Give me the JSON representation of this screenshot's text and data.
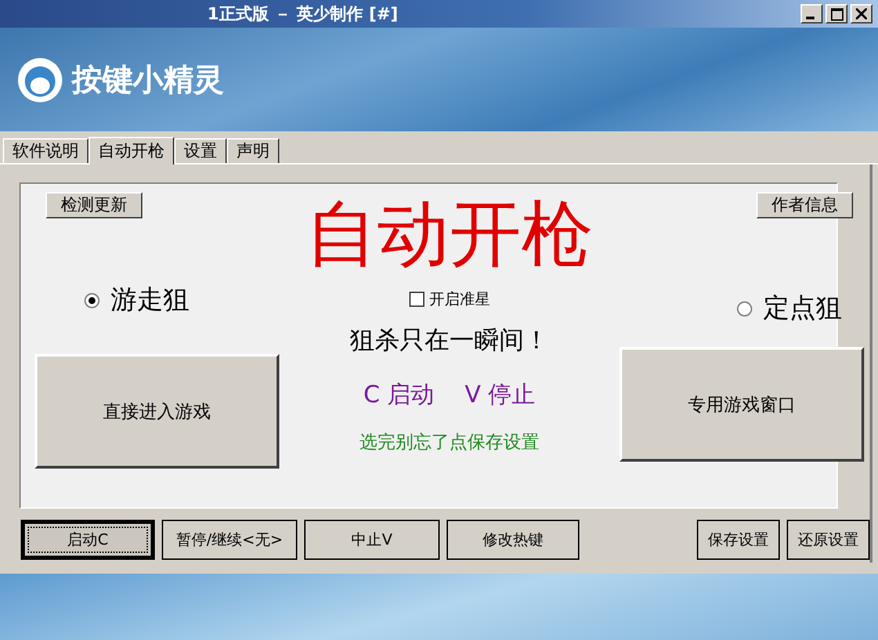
{
  "window": {
    "title": "1正式版 － 英少制作 [#]"
  },
  "banner": {
    "logo_text": "按键小精灵"
  },
  "tabs": [
    {
      "label": "软件说明",
      "selected": false
    },
    {
      "label": "自动开枪",
      "selected": true
    },
    {
      "label": "设置",
      "selected": false
    },
    {
      "label": "声明",
      "selected": false
    }
  ],
  "panel": {
    "update_button": "检测更新",
    "heading": "自动开枪",
    "author_button": "作者信息",
    "modes": [
      {
        "label": "游走狙",
        "selected": true
      },
      {
        "label": "定点狙",
        "selected": false
      }
    ],
    "crosshair": {
      "label": "开启准星",
      "checked": false
    },
    "enter_button": "直接进入游戏",
    "window_button": "专用游戏窗口",
    "slogan": "狙杀只在一瞬间！",
    "hotkeys": [
      "C 启动",
      "V 停止"
    ],
    "save_hint": "选完别忘了点保存设置"
  },
  "buttons": [
    {
      "label": "启动C",
      "focused": true
    },
    {
      "label": "暂停/继续<无>",
      "focused": false
    },
    {
      "label": "中止V",
      "focused": false
    },
    {
      "label": "修改热键",
      "focused": false
    }
  ],
  "settings_buttons": [
    {
      "label": "保存设置",
      "focused": false
    },
    {
      "label": "还原设置",
      "focused": false
    }
  ]
}
